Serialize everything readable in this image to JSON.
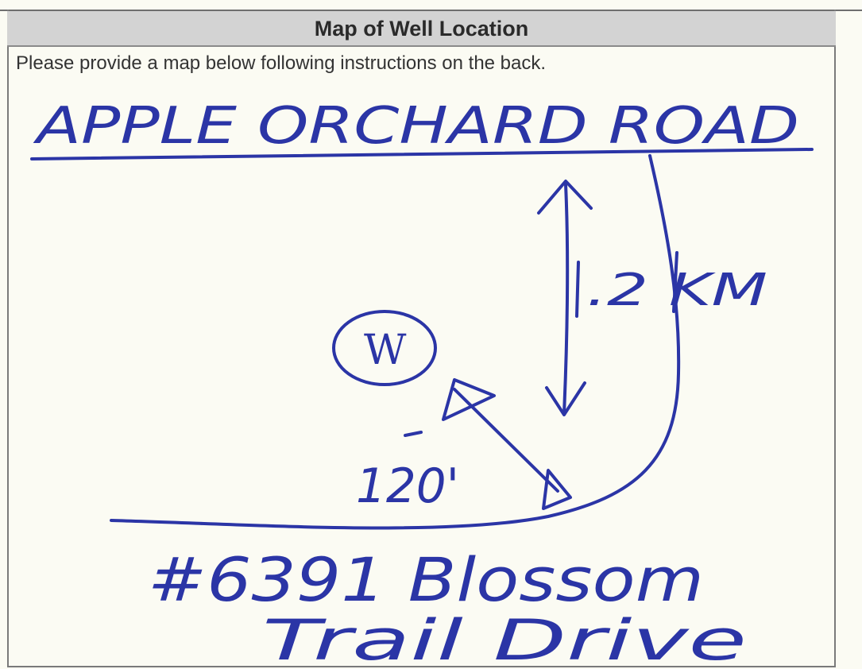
{
  "form": {
    "section_title": "Map of Well Location",
    "instructions": "Please provide a map below following instructions on the back."
  },
  "sketch": {
    "road_top_label": "APPLE ORCHARD ROAD",
    "distance_to_road_label": ".2 KM",
    "well_symbol": "W",
    "distance_to_house_label": "120'",
    "address_line1": "#6391 Blossom",
    "address_line2": "Trail Drive",
    "ink_color": "#2b35a6"
  }
}
